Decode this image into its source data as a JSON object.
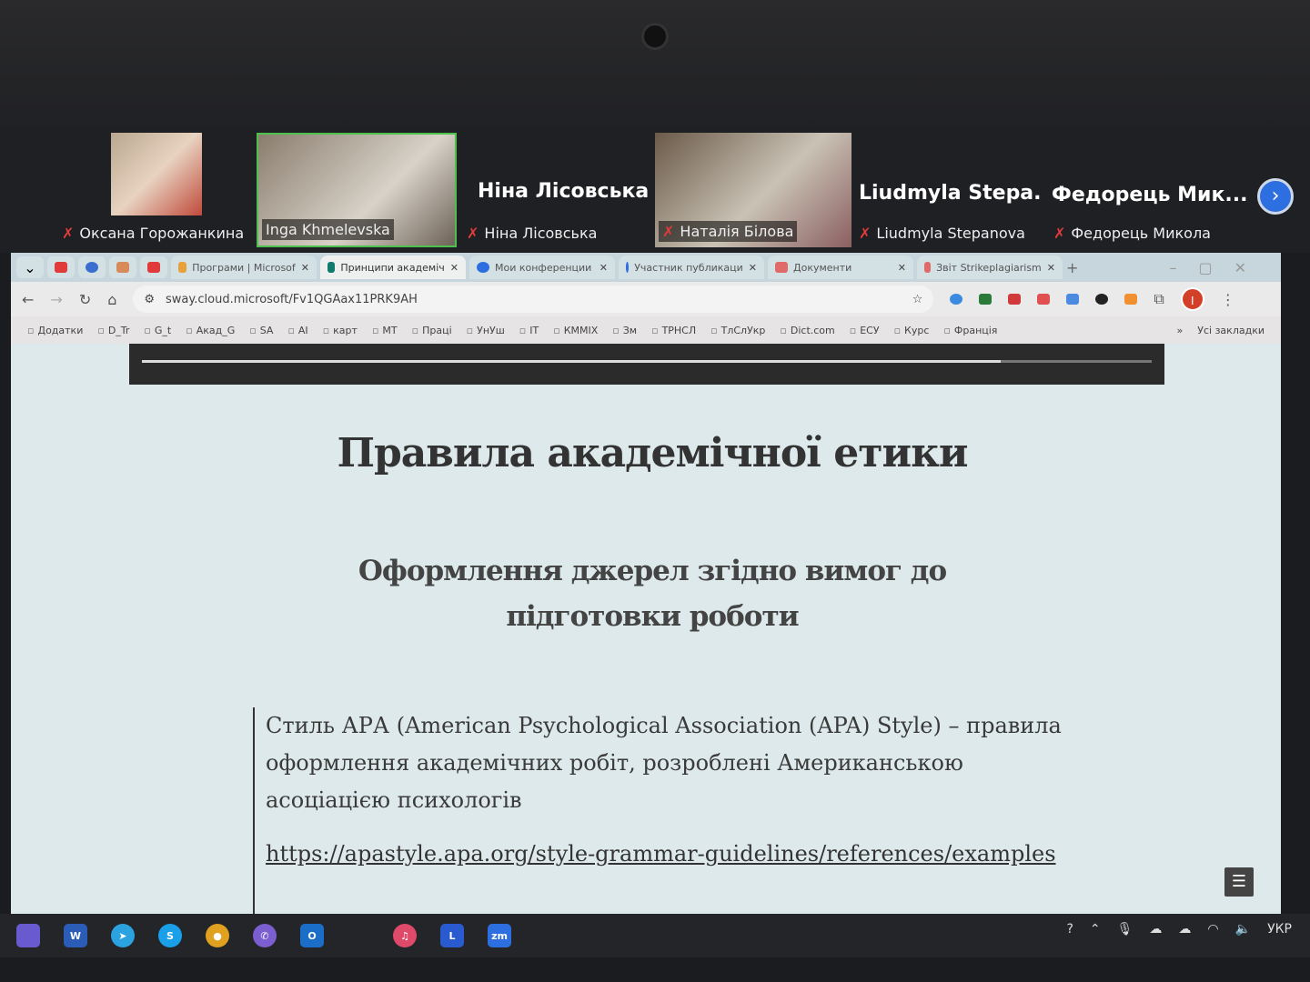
{
  "zoom": {
    "participants": [
      {
        "name": "Оксана Горожанкина",
        "video": true
      },
      {
        "name": "Inga Khmelevska",
        "video": true,
        "active_speaker": true
      },
      {
        "title": "Ніна Лісовська",
        "name": "Ніна Лісовська",
        "video": false
      },
      {
        "name": "Наталія Білова",
        "video": true
      },
      {
        "title": "Liudmyla Stepa...",
        "name": "Liudmyla Stepanova",
        "video": false
      },
      {
        "title": "Федорець Мик...",
        "name": "Федорець Микола",
        "video": false
      }
    ],
    "next_icon": "›"
  },
  "browser": {
    "tabs": [
      {
        "label": "Програми | Microsof",
        "active": false,
        "icon_color": "#e8a13a"
      },
      {
        "label": "Принципи академіч",
        "active": true,
        "icon_color": "#0f7b6c"
      },
      {
        "label": "Мои конференции",
        "active": false,
        "icon_color": "#2d6fe0"
      },
      {
        "label": "Участник публикаци",
        "active": false,
        "icon_color": "#2d6fe0"
      },
      {
        "label": "Документи",
        "active": false,
        "icon_color": "#e06a6a"
      },
      {
        "label": "Звіт Strikeplagiarism",
        "active": false,
        "icon_color": "#e06a6a"
      }
    ],
    "new_tab": "+",
    "url": "sway.cloud.microsoft/Fv1QGAax11PRK9AH",
    "bookmarks": [
      "Додатки",
      "D_Tr",
      "G_t",
      "Акад_G",
      "SA",
      "AI",
      "карт",
      "МТ",
      "Праці",
      "УнУш",
      "ІТ",
      "КММІХ",
      "Зм",
      "ТРНСЛ",
      "ТлСлУкр",
      "Dict.com",
      "ЕСУ",
      "Курс",
      "Франція"
    ],
    "more": "»",
    "all_bookmarks": "Усі закладки",
    "profile_letter": "I"
  },
  "slide": {
    "title": "Правила академічної етики",
    "subtitle": "Оформлення джерел згідно вимог до підготовки роботи",
    "body": "Стиль АРА (American Psychological Association (APA) Style) – правила оформлення академічних робіт, розроблені Американською асоціацією психологів",
    "link": "https://apastyle.apa.org/style-grammar-guidelines/references/examples",
    "progress": 0.85
  },
  "taskbar": {
    "language": "УКР"
  }
}
